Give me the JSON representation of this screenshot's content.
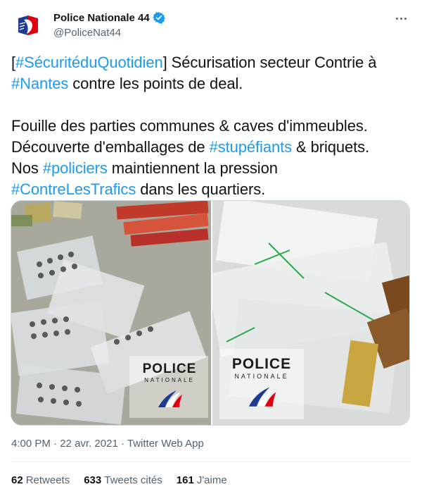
{
  "author": {
    "display_name": "Police Nationale 44",
    "handle": "@PoliceNat44"
  },
  "tweet": {
    "line1_pre": "[",
    "tag1": "#SécuritéduQuotidien",
    "line1_post": "] Sécurisation secteur Contrie à",
    "tag2": "#Nantes",
    "line2_post": " contre les points de deal.",
    "line3": "Fouille des parties communes & caves d'immeubles.",
    "line4_pre": "Découverte d'emballages de ",
    "tag3": "#stupéfiants",
    "line4_post": " & briquets.",
    "line5_pre": "Nos ",
    "tag4": "#policiers",
    "line5_post": " maintiennent la pression",
    "tag5": "#ContreLesTrafics",
    "line6_post": " dans les quartiers."
  },
  "media": {
    "logo_word1": "POLICE",
    "logo_word2": "NATIONALE"
  },
  "meta": {
    "time": "4:00 PM",
    "dot1": " · ",
    "date": "22 avr. 2021",
    "dot2": " · ",
    "source": "Twitter Web App"
  },
  "stats": {
    "retweets_count": "62",
    "retweets_label": "Retweets",
    "quotes_count": "633",
    "quotes_label": "Tweets cités",
    "likes_count": "161",
    "likes_label": "J'aime"
  },
  "colors": {
    "link": "#1d9bf0",
    "verified": "#1d9bf0",
    "muted": "#536471"
  },
  "icons": {
    "verified": "verified-badge-icon",
    "more": "more-options-icon"
  }
}
